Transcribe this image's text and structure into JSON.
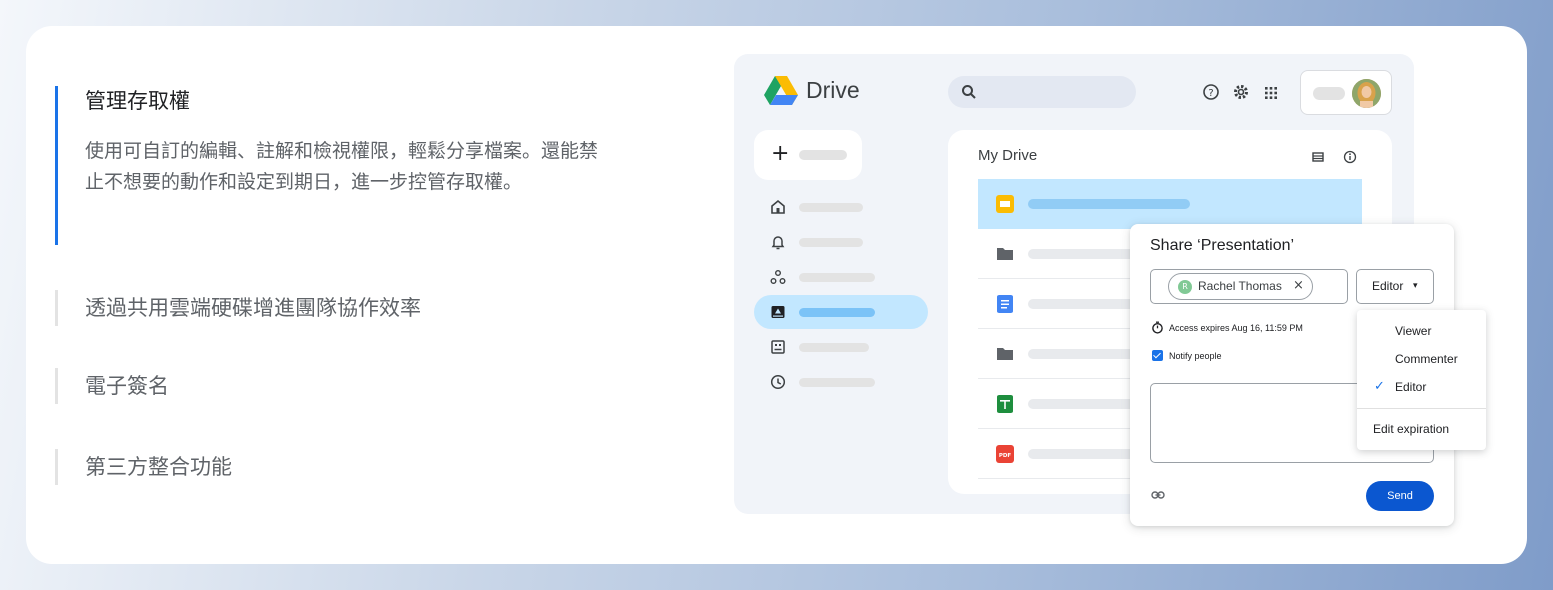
{
  "features": [
    {
      "title": "管理存取權",
      "desc": "使用可自訂的編輯、註解和檢視權限，輕鬆分享檔案。還能禁止不想要的動作和設定到期日，進一步控管存取權。",
      "active": true
    },
    {
      "title": "透過共用雲端硬碟增進團隊協作效率"
    },
    {
      "title": "電子簽名"
    },
    {
      "title": "第三方整合功能"
    }
  ],
  "drive": {
    "brand": "Drive",
    "files_title": "My Drive"
  },
  "share": {
    "title": "Share ‘Presentation’",
    "person": "Rachel Thomas",
    "person_initial": "R",
    "remove": "×",
    "role": "Editor",
    "caret": "▾",
    "expires": "Access expires Aug 16, 11:59 PM",
    "notify": "Notify people",
    "send": "Send"
  },
  "role_menu": {
    "items": [
      "Viewer",
      "Commenter",
      "Editor"
    ],
    "selected": "Editor",
    "check": "✓",
    "extra": "Edit expiration"
  },
  "colors": {
    "accent": "#1a73e8",
    "selected_row": "#c2e7ff",
    "send_button": "#0b57d0"
  }
}
